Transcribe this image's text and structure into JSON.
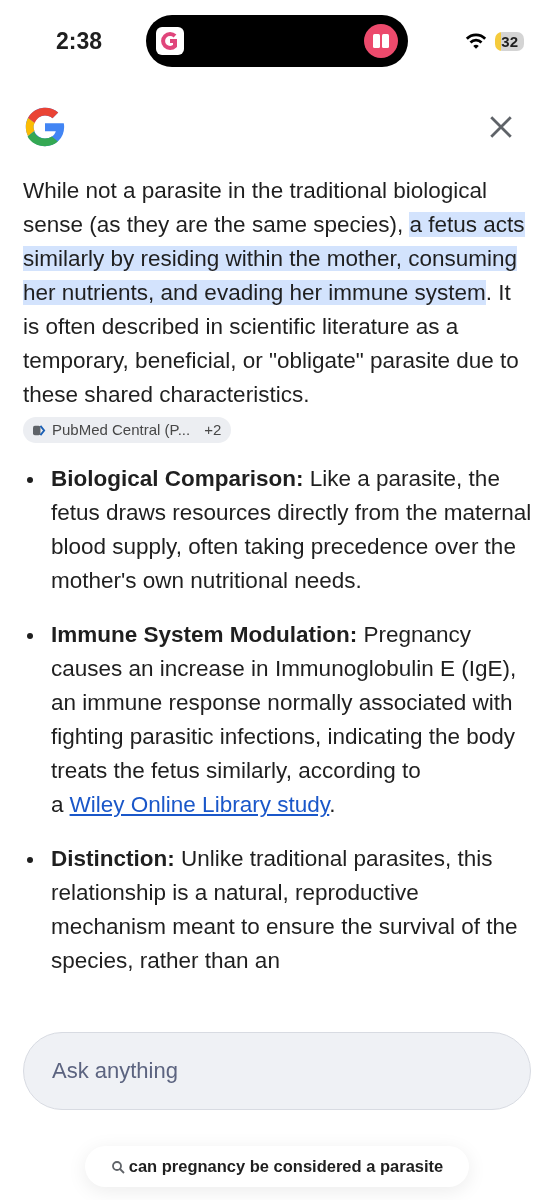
{
  "status_bar": {
    "time": "2:38",
    "battery": "32"
  },
  "answer": {
    "before": "While not a parasite in the traditional biological sense (as they are the same species), ",
    "highlight": "a fetus acts similarly by residing within the mother, consuming her nutrients, and evading her immune system",
    "after": ". It is often described in scientific literature as a temporary, beneficial, or \"obligate\" parasite due to these shared characteristics.",
    "source_chip": {
      "label": "PubMed Central (P...",
      "count": "+2"
    }
  },
  "bullets": [
    {
      "text": "**Biological Comparison:** Like a parasite, the fetus draws resources directly from the maternal blood supply, often taking precedence over the mother's own nutritional needs."
    },
    {
      "text": "**Immune System Modulation:** Pregnancy causes an increase in Immunoglobulin E (IgE), an immune response normally associated with fighting parasitic infections, indicating the body treats the fetus similarly, according to a",
      "link": "Wiley Online Library study",
      "after": "."
    },
    {
      "text": "**Distinction:** Unlike traditional parasites, this relationship is a natural, reproductive mechanism meant to ensure the survival of the species, rather than an"
    }
  ],
  "input": {
    "placeholder": "Ask anything"
  },
  "query_chip": "can pregnancy be considered a parasite"
}
